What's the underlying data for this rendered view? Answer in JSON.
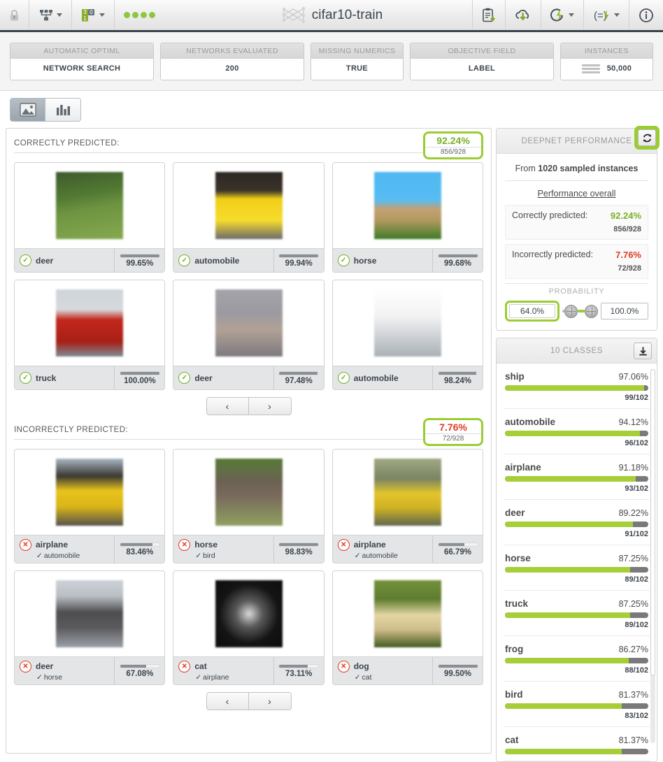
{
  "toolbar": {
    "left_icons": [
      {
        "name": "lock-icon",
        "glyph": "lock"
      },
      {
        "name": "network-icon",
        "glyph": "network"
      },
      {
        "name": "binary-icon",
        "glyph": "binary"
      },
      {
        "name": "status-dots",
        "glyph": "dots"
      }
    ],
    "title": "cifar10-train",
    "right_icons": [
      {
        "name": "clipboard-download-icon",
        "glyph": "clipboard"
      },
      {
        "name": "cloud-download-icon",
        "glyph": "cloud"
      },
      {
        "name": "flash-actions-icon",
        "glyph": "flash"
      },
      {
        "name": "script-flash-icon",
        "glyph": "script"
      },
      {
        "name": "info-icon",
        "glyph": "info"
      }
    ]
  },
  "summary": {
    "cards": [
      {
        "head": "AUTOMATIC OPTIML",
        "value": "NETWORK SEARCH"
      },
      {
        "head": "NETWORKS EVALUATED",
        "value": "200"
      },
      {
        "head": "MISSING NUMERICS",
        "value": "TRUE"
      },
      {
        "head": "OBJECTIVE FIELD",
        "value": "LABEL"
      },
      {
        "head": "INSTANCES",
        "value": "50,000"
      }
    ]
  },
  "view_tabs": [
    {
      "name": "tab-images",
      "icon": "image-icon",
      "active": true
    },
    {
      "name": "tab-chart",
      "icon": "bar-chart-icon",
      "active": false
    }
  ],
  "correct": {
    "title": "CORRECTLY PREDICTED:",
    "badge_pct": "92.24%",
    "badge_sub": "856/928",
    "cards": [
      {
        "label": "deer",
        "confidence": "99.65%",
        "bar": 100,
        "img": "deer-forest",
        "colors": [
          "#4c6b33",
          "#9fb87e",
          "#c9b89a"
        ]
      },
      {
        "label": "automobile",
        "confidence": "99.94%",
        "bar": 100,
        "img": "yellow-car",
        "colors": [
          "#2b2622",
          "#f2d117",
          "#8c8c8c"
        ]
      },
      {
        "label": "horse",
        "confidence": "99.68%",
        "bar": 100,
        "img": "horse-sky",
        "colors": [
          "#4db4ee",
          "#c8a679",
          "#4a7a2c"
        ]
      },
      {
        "label": "truck",
        "confidence": "100.00%",
        "bar": 100,
        "img": "red-truck",
        "colors": [
          "#cfd4d8",
          "#c0271c",
          "#7b8a95"
        ]
      },
      {
        "label": "deer",
        "confidence": "97.48%",
        "bar": 97,
        "img": "deer-grey",
        "colors": [
          "#9a9aa0",
          "#b7a99b",
          "#6e6a72"
        ]
      },
      {
        "label": "automobile",
        "confidence": "98.24%",
        "bar": 98,
        "img": "white-car",
        "colors": [
          "#ffffff",
          "#dcdcdc",
          "#aeb3b8"
        ]
      }
    ],
    "pager": {
      "prev": "‹",
      "next": "›"
    }
  },
  "incorrect": {
    "title": "INCORRECTLY PREDICTED:",
    "badge_pct": "7.76%",
    "badge_sub": "72/928",
    "cards": [
      {
        "label": "airplane",
        "truth": "automobile",
        "confidence": "83.46%",
        "bar": 83,
        "img": "yellow-car-blur",
        "colors": [
          "#a9b6c3",
          "#e8c21b",
          "#4c4a45"
        ]
      },
      {
        "label": "horse",
        "truth": "bird",
        "confidence": "98.83%",
        "bar": 99,
        "img": "emu-bird",
        "colors": [
          "#5c7a3a",
          "#6e6257",
          "#8b9a63"
        ]
      },
      {
        "label": "airplane",
        "truth": "automobile",
        "confidence": "66.79%",
        "bar": 67,
        "img": "yellow-van",
        "colors": [
          "#9aa47f",
          "#e0c22a",
          "#5c6450"
        ]
      },
      {
        "label": "deer",
        "truth": "horse",
        "confidence": "67.08%",
        "bar": 67,
        "img": "dark-horse",
        "colors": [
          "#c9cfd4",
          "#4b4a4c",
          "#8e939a"
        ]
      },
      {
        "label": "cat",
        "truth": "airplane",
        "confidence": "73.11%",
        "bar": 73,
        "img": "plane-dark",
        "colors": [
          "#161616",
          "#d8d8d8",
          "#3a3a3a"
        ]
      },
      {
        "label": "dog",
        "truth": "cat",
        "confidence": "99.50%",
        "bar": 100,
        "img": "puppy-grass",
        "colors": [
          "#6d8c3a",
          "#e6d9a8",
          "#3f5a22"
        ]
      }
    ],
    "pager": {
      "prev": "‹",
      "next": "›"
    }
  },
  "performance_panel": {
    "title": "DEEPNET PERFORMANCE",
    "refresh_icon": "refresh-icon",
    "sampled_prefix": "From ",
    "sampled_strong": "1020 sampled instances",
    "overall_title": "Performance overall",
    "rows": [
      {
        "label": "Correctly predicted:",
        "pct": "92.24%",
        "sub": "856/928",
        "kind": "ok"
      },
      {
        "label": "Incorrectly predicted:",
        "pct": "7.76%",
        "sub": "72/928",
        "kind": "bad"
      }
    ],
    "probability": {
      "label": "PROBABILITY",
      "min": "64.0%",
      "max": "100.0%"
    }
  },
  "classes_panel": {
    "title": "10 CLASSES",
    "download_icon": "download-icon",
    "items": [
      {
        "name": "ship",
        "pct": "97.06%",
        "value": 97.06,
        "sub": "99/102"
      },
      {
        "name": "automobile",
        "pct": "94.12%",
        "value": 94.12,
        "sub": "96/102"
      },
      {
        "name": "airplane",
        "pct": "91.18%",
        "value": 91.18,
        "sub": "93/102"
      },
      {
        "name": "deer",
        "pct": "89.22%",
        "value": 89.22,
        "sub": "91/102"
      },
      {
        "name": "horse",
        "pct": "87.25%",
        "value": 87.25,
        "sub": "89/102"
      },
      {
        "name": "truck",
        "pct": "87.25%",
        "value": 87.25,
        "sub": "89/102"
      },
      {
        "name": "frog",
        "pct": "86.27%",
        "value": 86.27,
        "sub": "88/102"
      },
      {
        "name": "bird",
        "pct": "81.37%",
        "value": 81.37,
        "sub": "83/102"
      },
      {
        "name": "cat",
        "pct": "81.37%",
        "value": 81.37,
        "sub": ""
      }
    ]
  },
  "colors": {
    "accent_green": "#9acd32",
    "ok_green": "#7bb026",
    "bad_red": "#e03b24",
    "bar_green": "#a6ce39",
    "dark": "#3c444c"
  }
}
